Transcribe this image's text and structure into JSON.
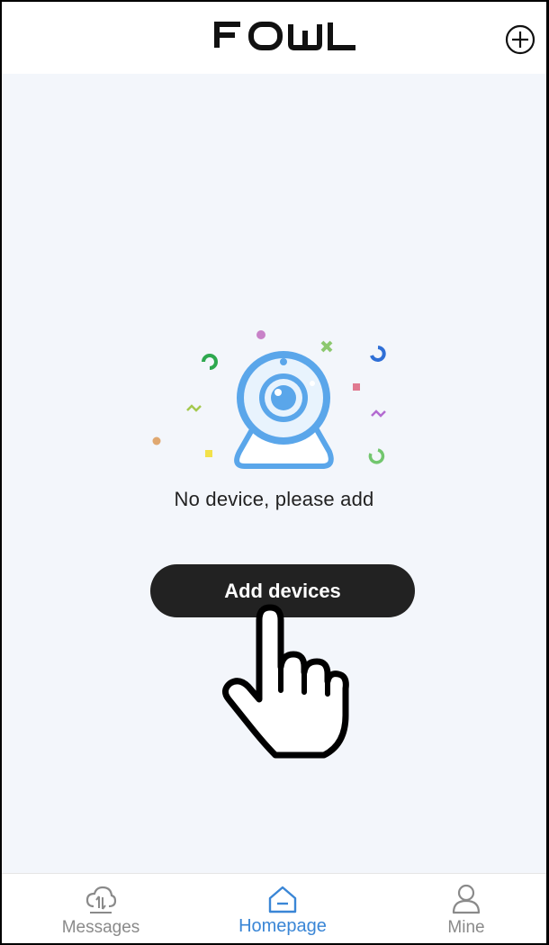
{
  "header": {
    "logo_text": "FOWL",
    "add_icon": "plus-circle-icon"
  },
  "main": {
    "empty_message": "No device, please add",
    "add_button_label": "Add devices",
    "illustration": "webcam-illustration",
    "accent_color": "#5aa6ea"
  },
  "tabbar": {
    "tabs": [
      {
        "label": "Messages",
        "icon": "cloud-icon",
        "active": false
      },
      {
        "label": "Homepage",
        "icon": "home-icon",
        "active": true
      },
      {
        "label": "Mine",
        "icon": "user-icon",
        "active": false
      }
    ],
    "active_color": "#3a86d6",
    "inactive_color": "#8a8a8a"
  }
}
